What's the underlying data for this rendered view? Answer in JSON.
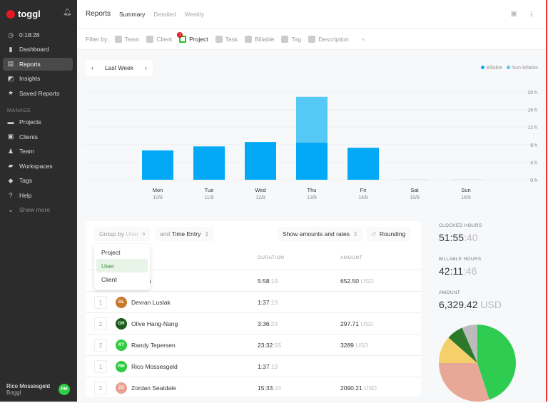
{
  "sidebar": {
    "brand": "toggl",
    "timer": "0:18:28",
    "items": [
      {
        "label": "Dashboard",
        "icon": "bar-chart-icon"
      },
      {
        "label": "Reports",
        "icon": "report-icon",
        "active": true
      },
      {
        "label": "Insights",
        "icon": "insights-icon"
      },
      {
        "label": "Saved Reports",
        "icon": "star-icon"
      }
    ],
    "manage_label": "MANAGE",
    "manage_items": [
      {
        "label": "Projects",
        "icon": "folder-icon"
      },
      {
        "label": "Clients",
        "icon": "client-icon"
      },
      {
        "label": "Team",
        "icon": "team-icon"
      },
      {
        "label": "Workspaces",
        "icon": "briefcase-icon"
      },
      {
        "label": "Tags",
        "icon": "tag-icon"
      },
      {
        "label": "Help",
        "icon": "help-icon"
      },
      {
        "label": "Show more",
        "icon": "chevron-down-icon"
      }
    ],
    "user": {
      "name": "Rico Mossesgeld",
      "workspace": "Boggl",
      "initials": "RM"
    }
  },
  "header": {
    "title": "Reports",
    "tabs": [
      "Summary",
      "Detailed",
      "Weekly"
    ],
    "active_tab": "Summary"
  },
  "filters": {
    "label": "Filter by:",
    "items": [
      "Team",
      "Client",
      "Project",
      "Task",
      "Billable",
      "Tag",
      "Description"
    ],
    "active": "Project",
    "project_badge": "1",
    "clear": "×"
  },
  "period": {
    "label": "Last Week",
    "prev": "‹",
    "next": "›"
  },
  "legend": {
    "billable": "Billable",
    "non_billable": "Non-billable",
    "billable_color": "#03a9f4",
    "non_billable_color": "#56c8f5"
  },
  "chart_data": {
    "type": "bar",
    "stacked": true,
    "categories": [
      "Mon",
      "Tue",
      "Wed",
      "Thu",
      "Fri",
      "Sat",
      "Sun"
    ],
    "dates": [
      "10/9",
      "11/9",
      "12/9",
      "13/9",
      "14/9",
      "15/9",
      "16/9"
    ],
    "series": [
      {
        "name": "Billable",
        "values": [
          6.7,
          7.6,
          8.6,
          8.5,
          7.3,
          0,
          0
        ]
      },
      {
        "name": "Non-billable",
        "values": [
          0,
          0,
          0,
          10.4,
          0,
          0,
          0
        ]
      }
    ],
    "yticks": [
      "20 h",
      "16 h",
      "12 h",
      "8 h",
      "4 h",
      "0 h"
    ],
    "ylim": [
      0,
      20
    ],
    "grid": true,
    "legend": "top-right"
  },
  "controls": {
    "group_by": "Group by",
    "group_value": "User",
    "sub_group": "and",
    "sub_value": "Time Entry",
    "amounts": "Show amounts and rates",
    "rounding": "Rounding"
  },
  "dropdown": {
    "options": [
      "Project",
      "User",
      "Client"
    ],
    "selected": "User"
  },
  "table": {
    "headers": {
      "duration": "DURATION",
      "amount": "AMOUNT"
    },
    "rows": [
      {
        "count": "",
        "initials": "",
        "name": "Yurram",
        "dur": "5:58",
        "sec": ":19",
        "amt": "652.50",
        "cur": "USD",
        "color": "#f5c85a"
      },
      {
        "count": "1",
        "initials": "DL",
        "name": "Devran Lustak",
        "dur": "1:37",
        "sec": ":19",
        "amt": "",
        "cur": "",
        "color": "#c8782a"
      },
      {
        "count": "2",
        "initials": "OH",
        "name": "Olive Hang-Nang",
        "dur": "3:36",
        "sec": ":24",
        "amt": "297.71",
        "cur": "USD",
        "color": "#1a5e1a"
      },
      {
        "count": "2",
        "initials": "RT",
        "name": "Randy Tepersen",
        "dur": "23:32",
        "sec": ":55",
        "amt": "3289",
        "cur": "USD",
        "color": "#2ecc40"
      },
      {
        "count": "1",
        "initials": "RM",
        "name": "Rico Mossesgeld",
        "dur": "1:37",
        "sec": ":19",
        "amt": "",
        "cur": "",
        "color": "#2ecc40"
      },
      {
        "count": "2",
        "initials": "ZS",
        "name": "Zordan Seatdale",
        "dur": "15:33",
        "sec": ":24",
        "amt": "2090.21",
        "cur": "USD",
        "color": "#e8a090"
      }
    ]
  },
  "stats": {
    "clocked_label": "CLOCKED HOURS",
    "clocked": "51:55",
    "clocked_sec": ":40",
    "billable_label": "BILLABLE HOURS",
    "billable": "42:11",
    "billable_sec": ":46",
    "amount_label": "AMOUNT",
    "amount": "6,329.42",
    "amount_cur": "USD"
  },
  "pie": [
    {
      "value": 45,
      "color": "#2ecc50"
    },
    {
      "value": 30,
      "color": "#e8a898"
    },
    {
      "value": 11.5,
      "color": "#f5cf6a"
    },
    {
      "value": 7,
      "color": "#2a7a2a"
    },
    {
      "value": 6.5,
      "color": "#bbbbbb"
    }
  ]
}
